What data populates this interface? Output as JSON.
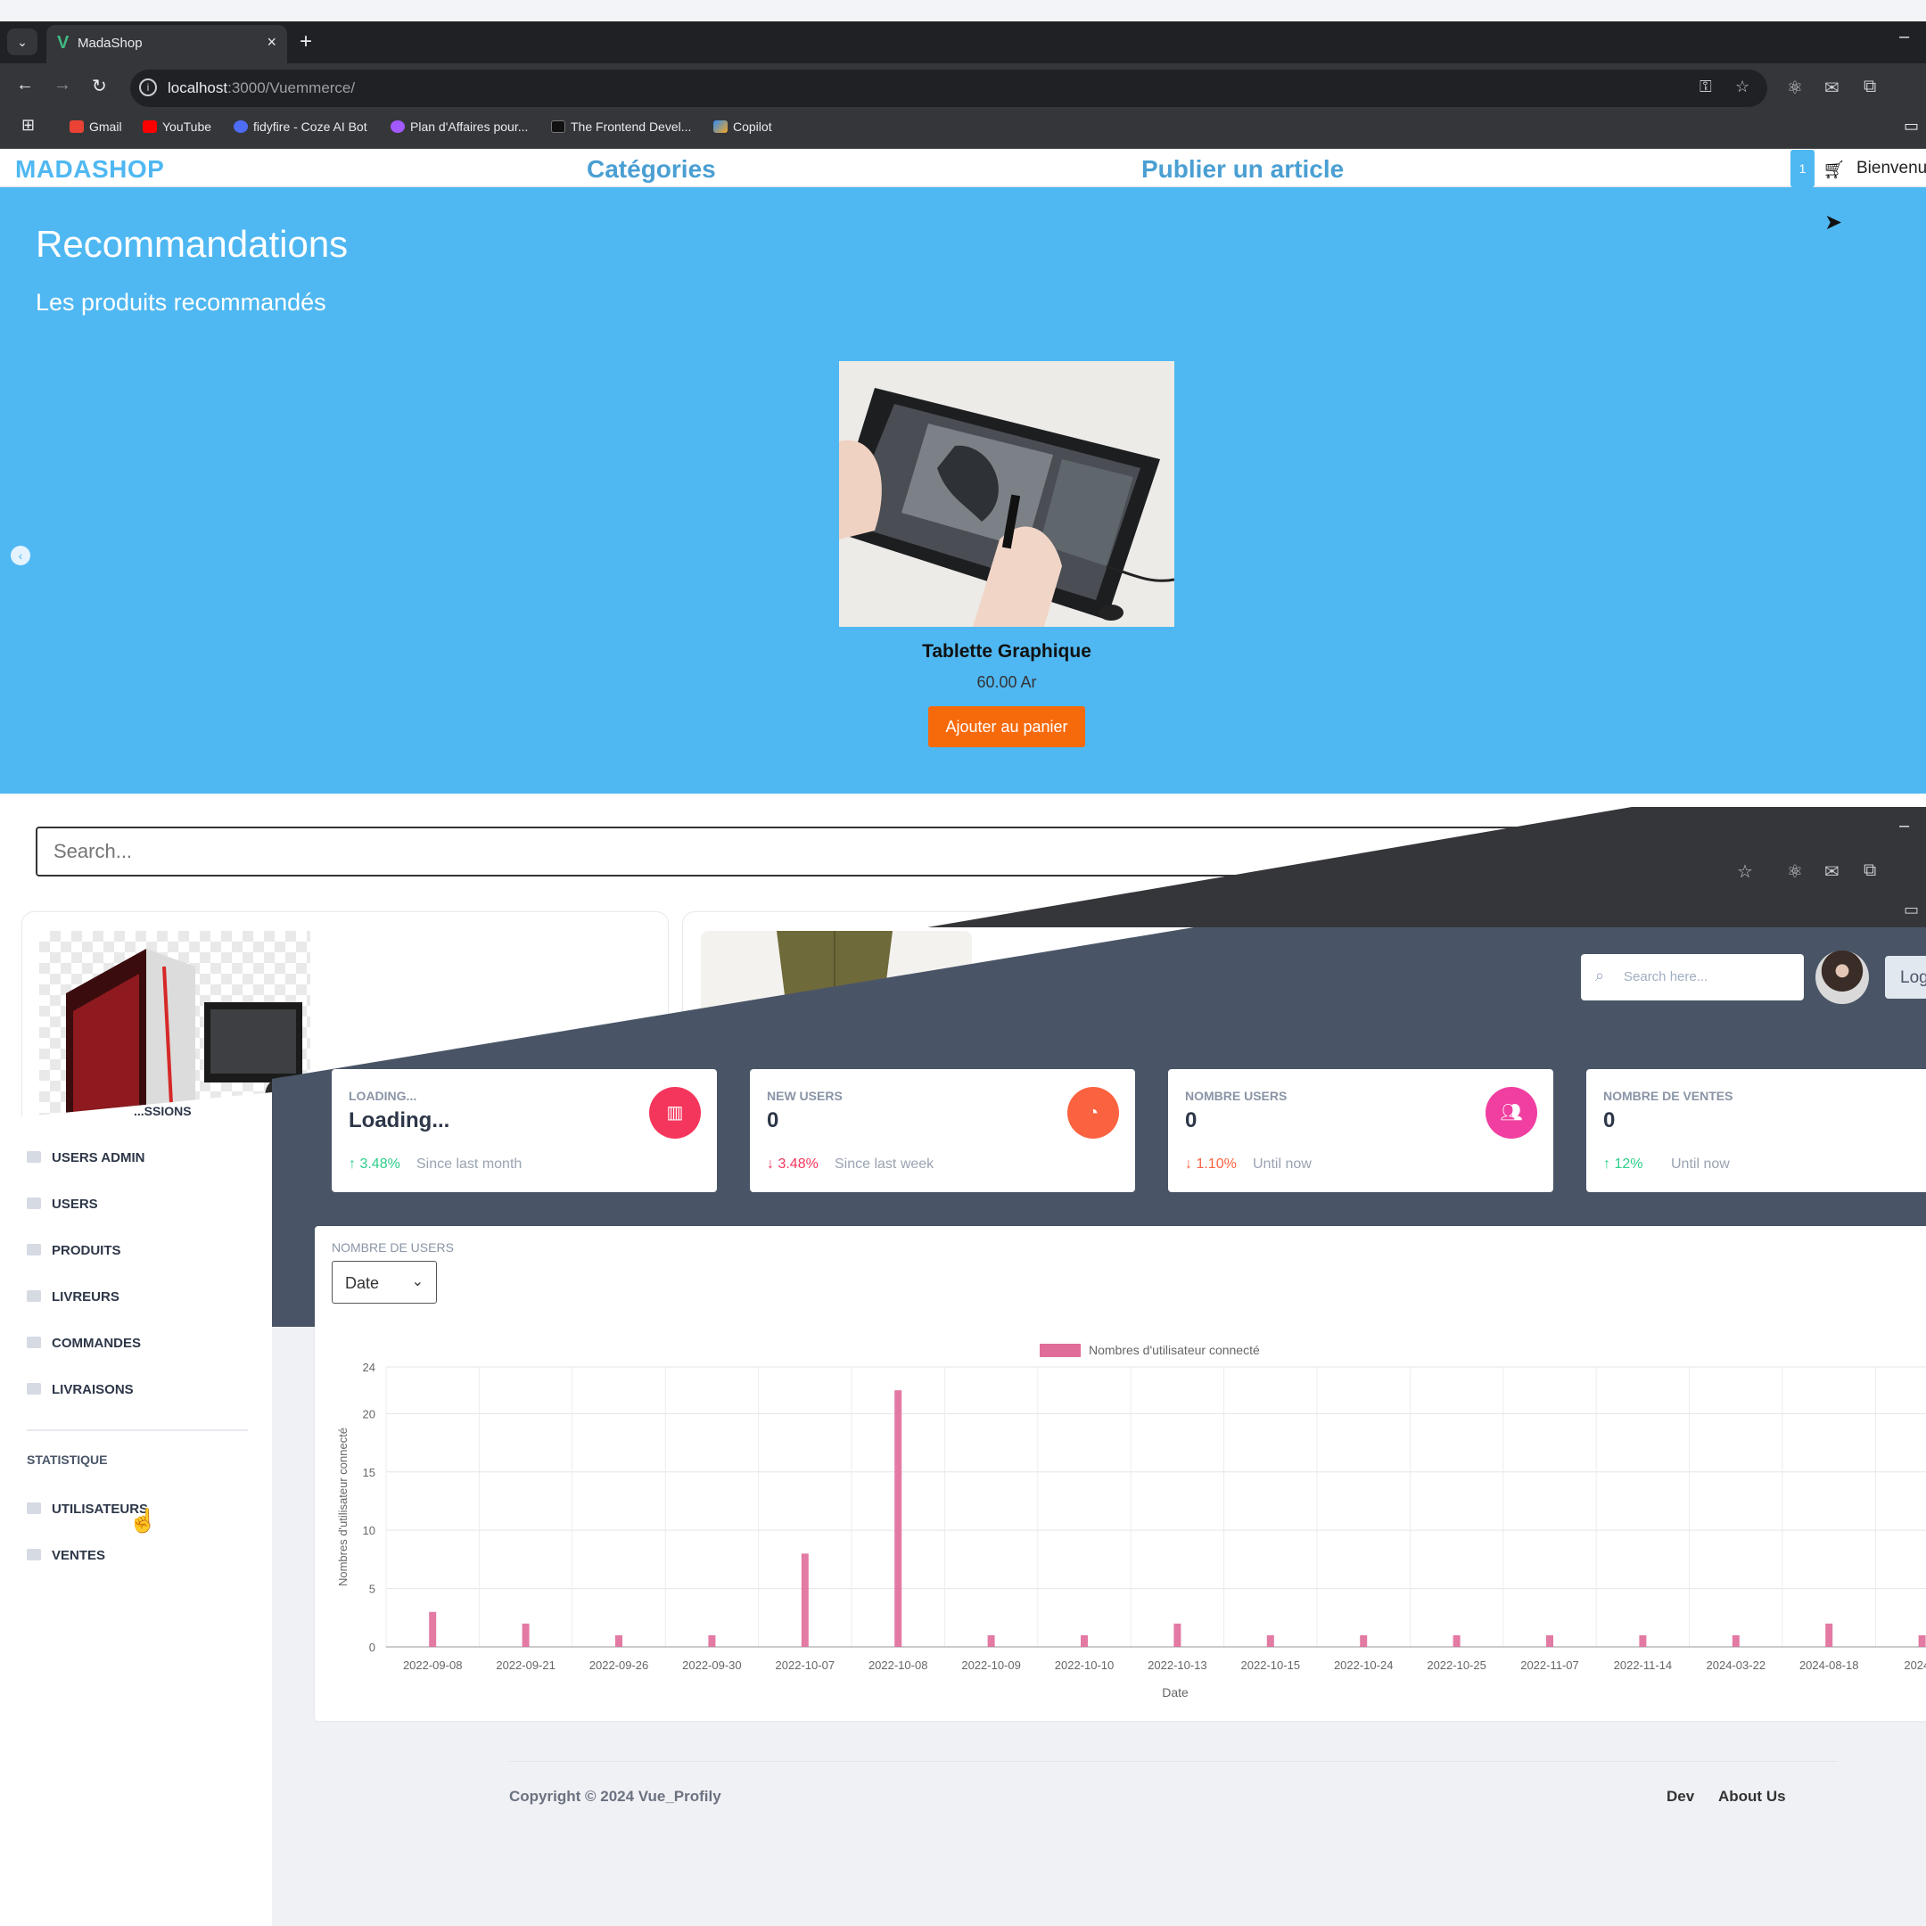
{
  "browser": {
    "tab_title": "MadaShop",
    "tab_close": "×",
    "new_tab": "+",
    "url_host": "localhost",
    "url_rest": ":3000/Vuemmerce/",
    "bookmarks": [
      {
        "label": "Gmail",
        "color": "#ea4335"
      },
      {
        "label": "YouTube",
        "color": "#ff0000"
      },
      {
        "label": "fidyfire - Coze AI Bot",
        "color": "#4f6cf7"
      },
      {
        "label": "Plan d'Affaires pour...",
        "color": "#a259ff"
      },
      {
        "label": "The Frontend Devel...",
        "color": "#111111"
      },
      {
        "label": "Copilot",
        "color": "#2f8cf0"
      }
    ]
  },
  "shop": {
    "logo": "MADASHOP",
    "nav_categories": "Catégories",
    "nav_publish": "Publier un article",
    "cart_count": "1",
    "welcome": "Bienvenu",
    "hero_title": "Recommandations",
    "hero_subtitle": "Les produits recommandés",
    "product": {
      "name": "Tablette Graphique",
      "price": "60.00 Ar",
      "button": "Ajouter au panier"
    },
    "search_placeholder": "Search..."
  },
  "admin": {
    "search_placeholder": "Search here...",
    "login_label": "Log",
    "sidebar_partial": "...SSIONS",
    "sidebar": [
      "USERS ADMIN",
      "USERS",
      "PRODUITS",
      "LIVREURS",
      "COMMANDES",
      "LIVRAISONS"
    ],
    "section_stat": "STATISTIQUE",
    "stat_items": [
      "UTILISATEURS",
      "VENTES"
    ],
    "cards": [
      {
        "label": "LOADING...",
        "value": "Loading...",
        "change": "3.48%",
        "trend": "up",
        "since": "Since last month",
        "icon_color": "#f5365c"
      },
      {
        "label": "NEW USERS",
        "value": "0",
        "change": "3.48%",
        "trend": "down",
        "since": "Since last week",
        "icon_color": "#fb6340"
      },
      {
        "label": "NOMBRE USERS",
        "value": "0",
        "change": "1.10%",
        "trend": "warn",
        "since": "Until now",
        "icon_color": "#f03fa0"
      },
      {
        "label": "NOMBRE DE VENTES",
        "value": "0",
        "change": "12%",
        "trend": "up",
        "since": "Until now",
        "icon_color": "#2dce89"
      }
    ],
    "chart_title": "NOMBRE DE USERS",
    "chart_select": "Date",
    "footer": {
      "copyright": "Copyright © 2024 Vue_Profily",
      "dev": "Dev",
      "about": "About Us"
    }
  },
  "chart_data": {
    "type": "bar",
    "title": "",
    "legend": [
      "Nombres d'utilisateur connecté"
    ],
    "legend_position": "top",
    "xlabel": "Date",
    "ylabel": "Nombres d'utilisateur connecté",
    "ylim": [
      0,
      24
    ],
    "yticks": [
      0,
      5,
      10,
      15,
      20,
      24
    ],
    "grid": true,
    "color": "#e06c9a",
    "categories": [
      "2022-09-08",
      "2022-09-21",
      "2022-09-26",
      "2022-09-30",
      "2022-10-07",
      "2022-10-08",
      "2022-10-09",
      "2022-10-10",
      "2022-10-13",
      "2022-10-15",
      "2022-10-24",
      "2022-10-25",
      "2022-11-07",
      "2022-11-14",
      "2024-03-22",
      "2024-08-18",
      "2024-0"
    ],
    "values": [
      3,
      2,
      1,
      1,
      8,
      22,
      1,
      1,
      2,
      1,
      1,
      1,
      1,
      1,
      1,
      2,
      1
    ]
  }
}
